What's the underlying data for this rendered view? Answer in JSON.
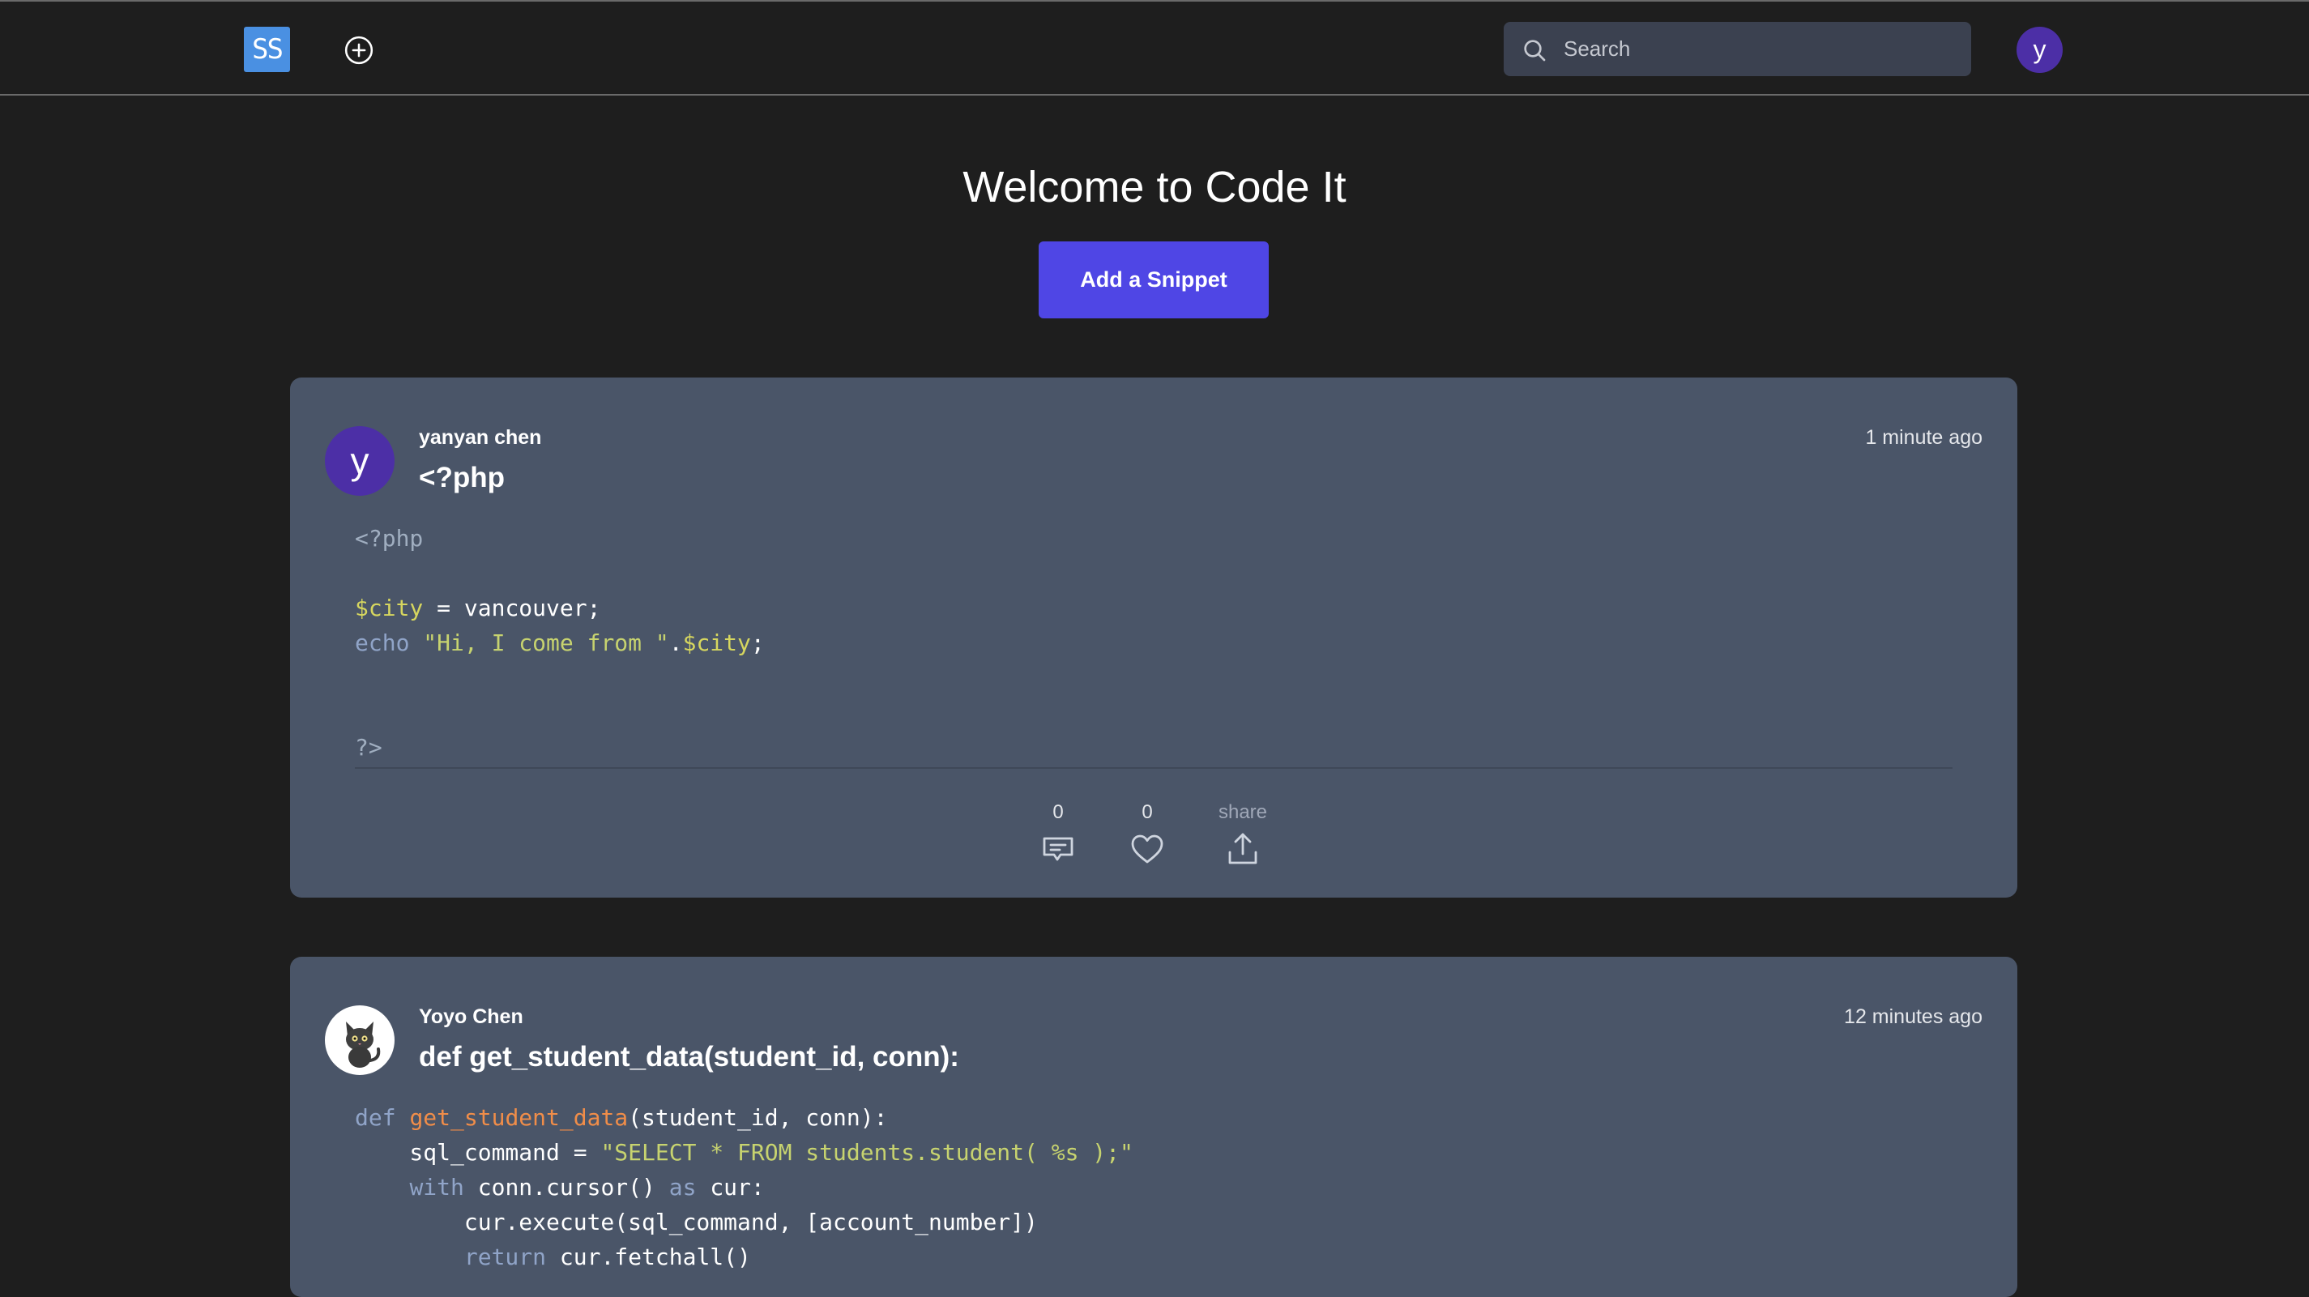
{
  "header": {
    "logo_text": "SS",
    "search_placeholder": "Search",
    "user_initial": "y"
  },
  "hero": {
    "title": "Welcome to Code It",
    "add_button": "Add a Snippet"
  },
  "snippets": [
    {
      "author": "yanyan chen",
      "avatar_initial": "y",
      "title": "<?php",
      "time": "1 minute ago",
      "code": [
        [
          {
            "t": "<?php",
            "c": "meta"
          }
        ],
        [],
        [
          {
            "t": "$city",
            "c": "var"
          },
          {
            "t": " = vancouver;",
            "c": "plain"
          }
        ],
        [
          {
            "t": "echo ",
            "c": "kw"
          },
          {
            "t": "\"Hi, I come from \"",
            "c": "str"
          },
          {
            "t": ".",
            "c": "plain"
          },
          {
            "t": "$city",
            "c": "var"
          },
          {
            "t": ";",
            "c": "plain"
          }
        ],
        [],
        [],
        [
          {
            "t": "?>",
            "c": "meta"
          }
        ]
      ],
      "comments": "0",
      "likes": "0",
      "share_label": "share"
    },
    {
      "author": "Yoyo Chen",
      "avatar_icon": "cat-avatar-icon",
      "title": "def get_student_data(student_id, conn):",
      "time": "12 minutes ago",
      "code": [
        [
          {
            "t": "def ",
            "c": "kw"
          },
          {
            "t": "get_student_data",
            "c": "fn"
          },
          {
            "t": "(student_id, conn):",
            "c": "plain"
          }
        ],
        [
          {
            "t": "    sql_command = ",
            "c": "plain"
          },
          {
            "t": "\"SELECT * FROM students.student( %s );\"",
            "c": "str"
          }
        ],
        [
          {
            "t": "    ",
            "c": "plain"
          },
          {
            "t": "with ",
            "c": "kw"
          },
          {
            "t": "conn.cursor() ",
            "c": "plain"
          },
          {
            "t": "as ",
            "c": "kw"
          },
          {
            "t": "cur:",
            "c": "plain"
          }
        ],
        [
          {
            "t": "        cur.execute(sql_command, [account_number])",
            "c": "plain"
          }
        ],
        [
          {
            "t": "        ",
            "c": "plain"
          },
          {
            "t": "return ",
            "c": "kw"
          },
          {
            "t": "cur.fetchall()",
            "c": "plain"
          }
        ]
      ]
    }
  ]
}
